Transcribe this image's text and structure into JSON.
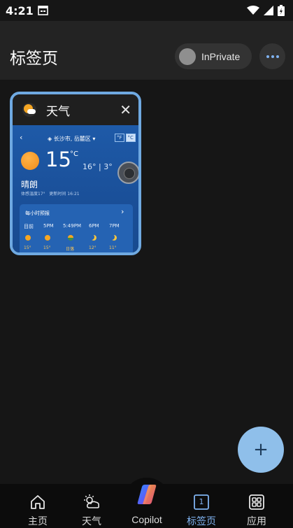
{
  "status_bar": {
    "time": "4:21"
  },
  "header": {
    "title": "标签页",
    "inprivate_label": "InPrivate"
  },
  "tab_card": {
    "title": "天气",
    "close_glyph": "✕",
    "preview": {
      "location": "◈ 长沙市, 岳麓区 ▾",
      "unit_f": "°F",
      "unit_c": "°C",
      "temperature": "15",
      "temp_unit": "°C",
      "high_low": "16° | 3°",
      "condition": "晴朗",
      "feels_like": "体感温度17°",
      "updated": "更新时间 16:21",
      "hourly_title": "每小时预报",
      "hours": [
        "目前",
        "5PM",
        "5:49PM",
        "6PM",
        "7PM"
      ],
      "hour_values": [
        "15°",
        "15°",
        "日落",
        "12°",
        "11°"
      ]
    }
  },
  "fab": {
    "label": "+"
  },
  "bottom_nav": {
    "items": [
      {
        "label": "主页",
        "icon": "home-icon"
      },
      {
        "label": "天气",
        "icon": "weather-icon"
      },
      {
        "label": "Copilot",
        "icon": "copilot-icon"
      },
      {
        "label": "标签页",
        "icon": "tabs-icon",
        "count": "1",
        "active": true
      },
      {
        "label": "应用",
        "icon": "apps-icon"
      }
    ]
  },
  "colors": {
    "accent": "#7fb2f0",
    "fab": "#8fbfea",
    "card_border": "#6fa9e1",
    "background": "#161616"
  }
}
